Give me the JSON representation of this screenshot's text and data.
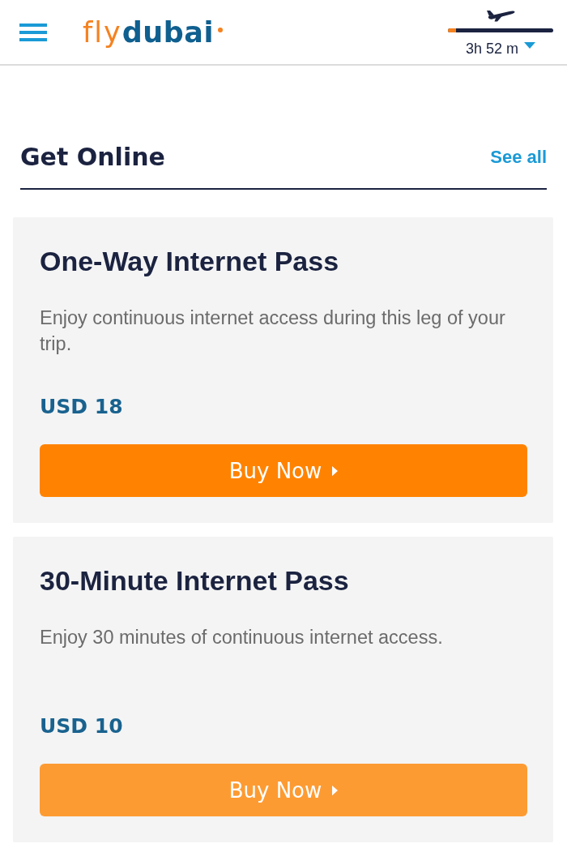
{
  "header": {
    "logo": {
      "part_1": "fly",
      "part_2": "dubai"
    },
    "flight": {
      "level": 0.08,
      "time_remaining": "3h 52 m"
    }
  },
  "section": {
    "title": "Get Online",
    "link": "See all"
  },
  "passes": [
    {
      "title": "One-Way Internet Pass",
      "description": "Enjoy continuous internet access during this leg of your trip.",
      "price": "USD 18",
      "button": {
        "label": "Buy Now",
        "color": "#ff8300"
      }
    },
    {
      "title": "30-Minute Internet Pass",
      "description": "Enjoy 30 minutes of continuous internet access.",
      "price": "USD 10",
      "button": {
        "label": "Buy Now",
        "color": "#fd9b33"
      }
    }
  ]
}
